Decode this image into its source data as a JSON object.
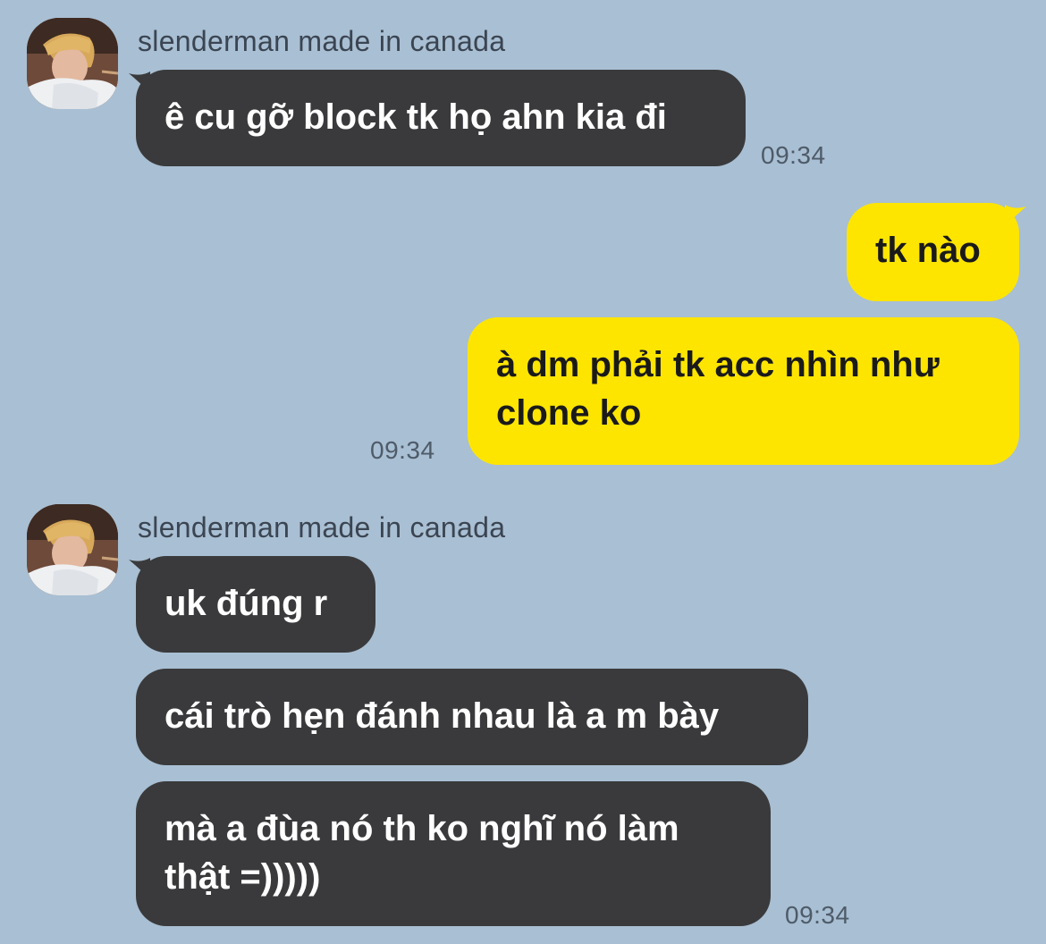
{
  "colors": {
    "background": "#a9bfd3",
    "incoming_bubble": "#3a3a3c",
    "outgoing_bubble": "#fee500",
    "incoming_text": "#ffffff",
    "outgoing_text": "#1a1a1a",
    "timestamp": "#4e5b69"
  },
  "messages": {
    "group1": {
      "sender": "slenderman made in canada",
      "bubble1": "ê cu gỡ block tk họ ahn kia đi",
      "time": "09:34"
    },
    "group2": {
      "bubble1": "tk nào",
      "bubble2": "à dm phải tk acc nhìn như clone ko",
      "time": "09:34"
    },
    "group3": {
      "sender": "slenderman made in canada",
      "bubble1": "uk đúng r",
      "bubble2": "cái trò hẹn đánh nhau là a m bày",
      "bubble3": "mà a đùa nó th ko nghĩ nó làm thật =)))))",
      "time": "09:34"
    }
  }
}
